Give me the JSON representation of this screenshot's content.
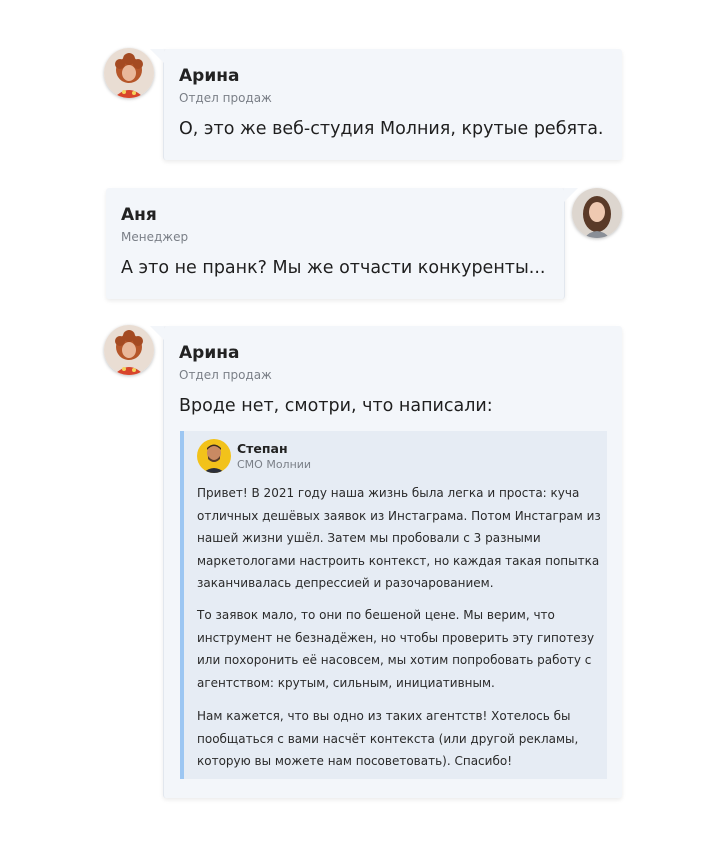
{
  "messages": [
    {
      "author": "Арина",
      "role": "Отдел продаж",
      "text": "О, это же веб-студия Молния, крутые ребята.",
      "avatar_icon": "avatar-arina"
    },
    {
      "author": "Аня",
      "role": "Менеджер",
      "text": "А это не пранк? Мы же отчасти конкуренты...",
      "avatar_icon": "avatar-anya"
    },
    {
      "author": "Арина",
      "role": "Отдел продаж",
      "text": "Вроде нет, смотри, что написали:",
      "avatar_icon": "avatar-arina",
      "quote": {
        "author": "Степан",
        "role": "CMO Молнии",
        "avatar_icon": "avatar-stepan",
        "paragraphs": [
          "Привет! В 2021 году наша жизнь была легка и проста: куча отличных дешёвых заявок из Инстаграма. Потом Инстаграм из нашей жизни ушёл. Затем мы пробовали с 3 разными маркетологами настроить контекст, но каждая такая попытка заканчивалась депрессией и разочарованием.",
          "То заявок мало, то они по бешеной цене. Мы верим, что инструмент не безнадёжен, но чтобы проверить эту гипотезу или похоронить её насовсем, мы хотим попробовать работу с агентством: крутым, сильным, инициативным.",
          "Нам кажется, что вы одно из таких агентств! Хотелось бы пообщаться с вами насчёт контекста (или другой рекламы, которую вы можете нам посоветовать). Спасибо!"
        ]
      }
    }
  ],
  "colors": {
    "bubble_bg": "#f3f6fa",
    "quote_bg": "#e6ecf4",
    "quote_border": "#9cc6f2",
    "role_text": "#7a7f87"
  }
}
